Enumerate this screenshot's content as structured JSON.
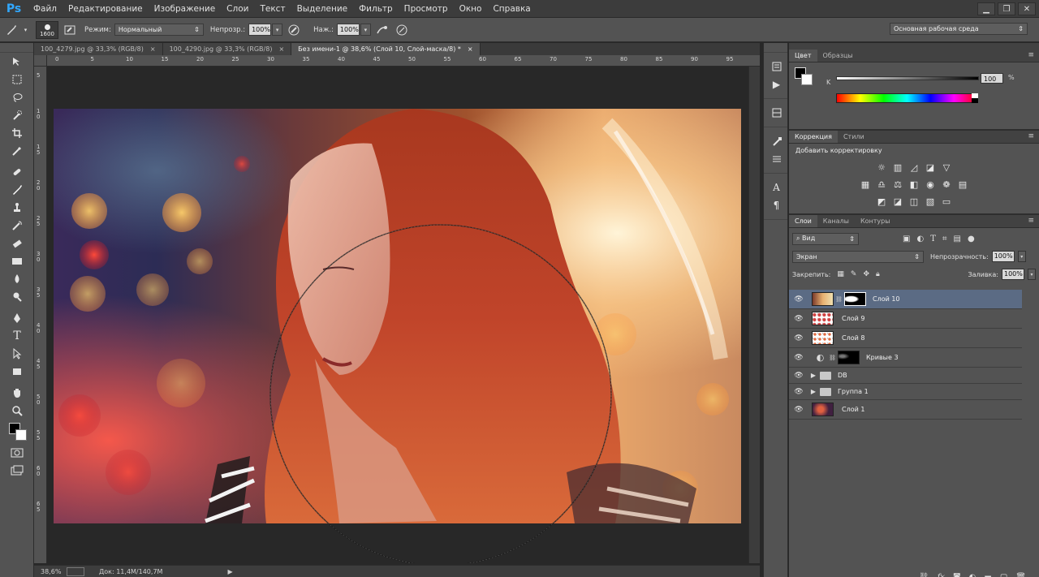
{
  "app": {
    "logo": "Ps",
    "menu": [
      "Файл",
      "Редактирование",
      "Изображение",
      "Слои",
      "Текст",
      "Выделение",
      "Фильтр",
      "Просмотр",
      "Окно",
      "Справка"
    ]
  },
  "options": {
    "brush_size": "1600",
    "mode_label": "Режим:",
    "mode_value": "Нормальный",
    "opacity_label": "Непрозр.:",
    "opacity_value": "100%",
    "flow_label": "Наж.:",
    "flow_value": "100%",
    "workspace": "Основная рабочая среда"
  },
  "tabs": [
    {
      "title": "100_4279.jpg @ 33,3% (RGB/8)",
      "close": "×"
    },
    {
      "title": "100_4290.jpg @ 33,3% (RGB/8)",
      "close": "×"
    },
    {
      "title": "Без имени-1 @ 38,6% (Слой 10, Слой-маска/8) *",
      "close": "×"
    }
  ],
  "ruler_h": [
    "0",
    "5",
    "10",
    "15",
    "20",
    "25",
    "30",
    "35",
    "40",
    "45",
    "50",
    "55",
    "60",
    "65",
    "70",
    "75",
    "80",
    "85",
    "90",
    "95"
  ],
  "ruler_v": [
    "5",
    "1 0",
    "1 5",
    "2 0",
    "2 5",
    "3 0",
    "3 5",
    "4 0",
    "4 5",
    "5 0",
    "5 5",
    "6 0",
    "6 5"
  ],
  "status": {
    "zoom": "38,6%",
    "doc": "Док: 11,4M/140,7M"
  },
  "panels": {
    "color_tabs": [
      "Цвет",
      "Образцы"
    ],
    "color_channel": "K",
    "color_value": "100",
    "color_unit": "%",
    "adj_tabs": [
      "Коррекция",
      "Стили"
    ],
    "adj_title": "Добавить корректировку",
    "layer_tabs": [
      "Слои",
      "Каналы",
      "Контуры"
    ],
    "filter_kind": "Вид",
    "blend_mode": "Экран",
    "opacity_label": "Непрозрачность:",
    "opacity_value": "100%",
    "lock_label": "Закрепить:",
    "fill_label": "Заливка:",
    "fill_value": "100%",
    "layers": [
      {
        "name": "Слой 10",
        "selected": true
      },
      {
        "name": "Слой 9"
      },
      {
        "name": "Слой 8"
      },
      {
        "name": "Кривые 3"
      },
      {
        "name": "DB"
      },
      {
        "name": "Группа 1"
      },
      {
        "name": "Слой 1"
      }
    ]
  }
}
